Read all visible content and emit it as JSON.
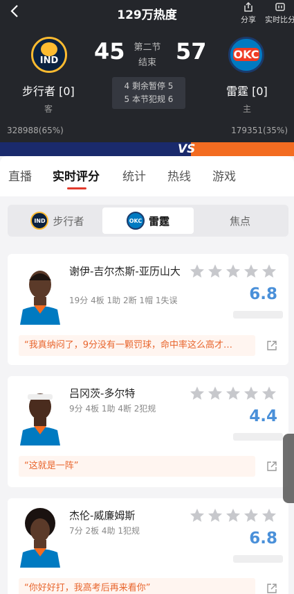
{
  "header": {
    "heat": "129万热度",
    "share_label": "分享",
    "compare_label": "实时比分",
    "home_score": "45",
    "away_score": "57",
    "period": "第二节",
    "status": "结束",
    "left_team": {
      "name": "步行者 [0]",
      "side": "客",
      "logo": "IND",
      "votes": "328988(65%)"
    },
    "right_team": {
      "name": "雷霆 [0]",
      "side": "主",
      "logo": "OKC",
      "votes": "179351(35%)"
    },
    "info_line1": "4 剩余暂停 5",
    "info_line2": "5 本节犯规 6",
    "vs": "VS",
    "vote_split": [
      0.65,
      0.35
    ]
  },
  "tabs": [
    "直播",
    "实时评分",
    "统计",
    "热线",
    "游戏"
  ],
  "team_switch": {
    "left": "步行者",
    "middle": "雷霆",
    "right": "焦点",
    "left_logo": "IND",
    "middle_logo": "OKC"
  },
  "players": [
    {
      "name": "谢伊-吉尔杰斯-亚历山大",
      "stats": "19分 4板 1助 2断 1帽 1失误",
      "rating": "6.8",
      "comment": "“我真纳闷了，9分没有一颗罚球，命中率这么高才…"
    },
    {
      "name": "吕冈茨-多尔特",
      "stats": "9分 4板 1助 4断 2犯规",
      "rating": "4.4",
      "comment": "“这就是一阵”"
    },
    {
      "name": "杰伦-威廉姆斯",
      "stats": "7分 2板 4助 1犯规",
      "rating": "6.8",
      "comment": "“你好好打，我高考后再来看你”"
    }
  ],
  "colors": {
    "accent": "#e23a2c",
    "rating": "#4a90d9",
    "comment": "#e8652d",
    "pacers": "#fdbb30",
    "thunder": "#007ac1"
  }
}
